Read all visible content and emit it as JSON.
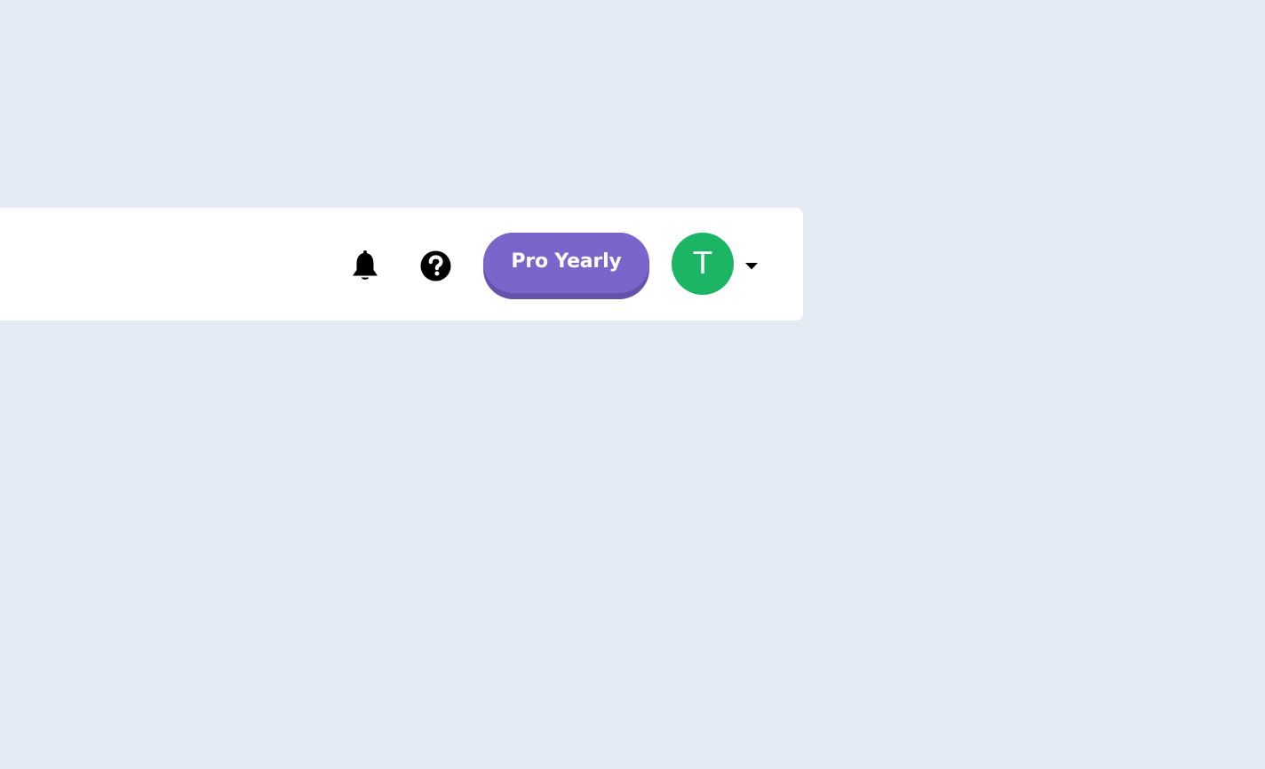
{
  "header": {
    "plan_button_label": "Pro Yearly",
    "avatar_initial": "T",
    "icons": {
      "notifications": "bell-icon",
      "help": "question-circle-icon",
      "account_menu": "caret-down-icon"
    }
  },
  "colors": {
    "page_background": "#e4ebf4",
    "header_background": "#ffffff",
    "plan_button": "#7a66cb",
    "plan_button_shadow": "#6452ad",
    "avatar": "#1bb565",
    "icon": "#000000"
  }
}
